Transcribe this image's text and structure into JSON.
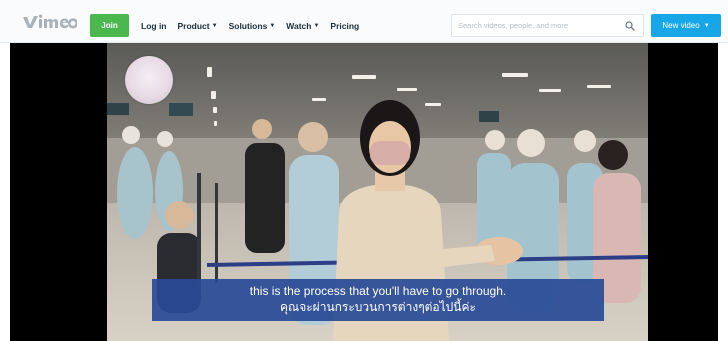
{
  "header": {
    "logo_text": "vimeo",
    "join_label": "Join",
    "nav": [
      {
        "label": "Log in",
        "has_dropdown": false
      },
      {
        "label": "Product",
        "has_dropdown": true
      },
      {
        "label": "Solutions",
        "has_dropdown": true
      },
      {
        "label": "Watch",
        "has_dropdown": true
      },
      {
        "label": "Pricing",
        "has_dropdown": false
      }
    ],
    "search": {
      "placeholder": "Search videos, people, and more",
      "value": ""
    },
    "new_video_label": "New video",
    "icons": {
      "search": "search-icon",
      "dropdown": "chevron-down-icon"
    }
  },
  "player": {
    "captions": {
      "line1": "this is the process that you'll have to go through.",
      "line2": "คุณจะผ่านกระบวนการต่างๆต่อไปนี้ค่ะ"
    }
  },
  "colors": {
    "join": "#4ab74f",
    "new_video": "#17a6e8",
    "caption_bg": "#284a96",
    "nav_text": "#1a2e3b"
  }
}
